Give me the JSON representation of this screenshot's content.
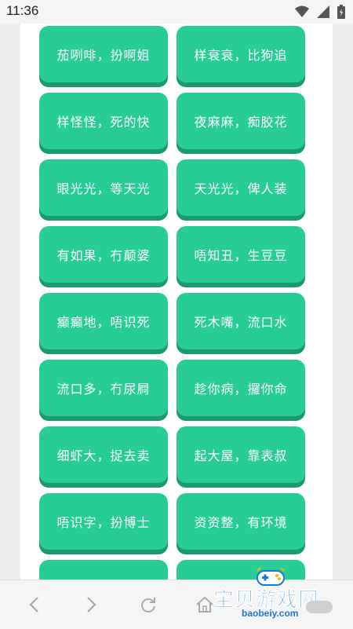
{
  "status_bar": {
    "time": "11:36",
    "icons": [
      "wifi-icon",
      "signal-icon",
      "battery-icon"
    ]
  },
  "buttons": [
    "茄咧啡，扮啊姐",
    "样衰衰，比狗追",
    "样怪怪，死的快",
    "夜麻麻，痴胶花",
    "眼光光，等天光",
    "天光光，俾人装",
    "有如果，冇颠婆",
    "唔知丑，生豆豆",
    "癫癫地，唔识死",
    "死木嘴，流口水",
    "流口多，冇尿屙",
    "趁你病，攞你命",
    "细虾大，捉去卖",
    "起大屋，靠表叔",
    "唔识字，扮博士",
    "资资整，有环境",
    "",
    ""
  ],
  "bottom_nav": {
    "icons": [
      "back-icon",
      "forward-icon",
      "refresh-icon",
      "home-icon"
    ]
  },
  "watermark": {
    "title": "宝贝游戏网",
    "url": "baobeiy.com"
  },
  "colors": {
    "button": "#27cd95",
    "button_shadow": "#1b9a6c",
    "watermark": "#1d77d8"
  }
}
